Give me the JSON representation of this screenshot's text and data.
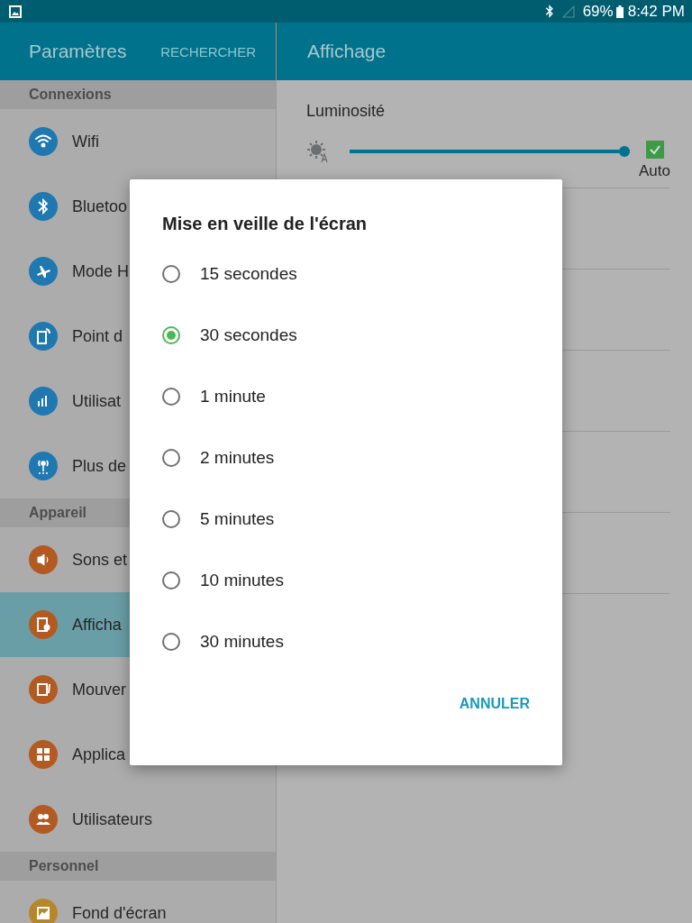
{
  "status_bar": {
    "battery": "69%",
    "time": "8:42 PM"
  },
  "header": {
    "title": "Paramètres",
    "search": "RECHERCHER",
    "page_title": "Affichage"
  },
  "sidebar": [
    {
      "section": "Connexions",
      "items": [
        {
          "label": "Wifi",
          "color": "#1f78b0",
          "selected": false
        },
        {
          "label": "Bluetoo",
          "color": "#1f78b0",
          "selected": false
        },
        {
          "label": "Mode H",
          "color": "#1f78b0",
          "selected": false
        },
        {
          "label": "Point d",
          "color": "#1f78b0",
          "selected": false
        },
        {
          "label": "Utilisat",
          "color": "#1f78b0",
          "selected": false
        },
        {
          "label": "Plus de",
          "color": "#1f78b0",
          "selected": false
        }
      ]
    },
    {
      "section": "Appareil",
      "items": [
        {
          "label": "Sons et",
          "color": "#b35a22",
          "selected": false
        },
        {
          "label": "Afficha",
          "color": "#b35a22",
          "selected": true
        },
        {
          "label": "Mouver",
          "color": "#b35a22",
          "selected": false
        },
        {
          "label": "Applica",
          "color": "#b35a22",
          "selected": false
        },
        {
          "label": "Utilisateurs",
          "color": "#b35a22",
          "selected": false
        }
      ]
    },
    {
      "section": "Personnel",
      "items": [
        {
          "label": "Fond d'écran",
          "color": "#b8862a",
          "selected": false
        }
      ]
    }
  ],
  "brightness": {
    "label": "Luminosité",
    "level": 1.0,
    "auto_label": "Auto",
    "auto_checked": true
  },
  "dialog": {
    "title": "Mise en veille de l'écran",
    "options": [
      {
        "label": "15 secondes",
        "selected": false
      },
      {
        "label": "30 secondes",
        "selected": true
      },
      {
        "label": "1 minute",
        "selected": false
      },
      {
        "label": "2 minutes",
        "selected": false
      },
      {
        "label": "5 minutes",
        "selected": false
      },
      {
        "label": "10 minutes",
        "selected": false
      },
      {
        "label": "30 minutes",
        "selected": false
      }
    ],
    "cancel": "ANNULER"
  }
}
